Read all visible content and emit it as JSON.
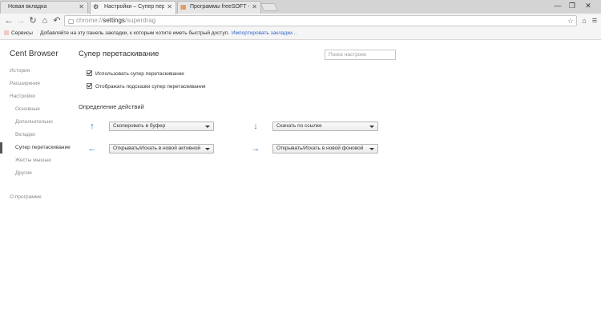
{
  "window": {
    "tabs": [
      {
        "title": "Новая вкладка",
        "icon": "blank-page-icon",
        "active": false
      },
      {
        "title": "Настройки – Супер перетаскивание",
        "icon": "gear-icon",
        "active": true
      },
      {
        "title": "Программы freeSOFT - ...",
        "icon": "site-icon",
        "active": false
      }
    ],
    "controls": {
      "minimize": "—",
      "maximize": "❐",
      "close": "✕"
    }
  },
  "toolbar": {
    "back": "←",
    "forward": "→",
    "reload": "↻",
    "home": "⌂",
    "undo": "↶",
    "url_scheme": "chrome://",
    "url_host": "settings",
    "url_path": "/superdrag",
    "star": "☆",
    "extensions": "⌂",
    "menu": "≡"
  },
  "bookmarks_bar": {
    "apps_label": "Сервисы",
    "hint": "Добавляйте на эту панель закладки, к которым хотите иметь быстрый доступ.",
    "import_link": "Импортировать закладки..."
  },
  "sidebar": {
    "brand": "Cent Browser",
    "items": [
      {
        "label": "История"
      },
      {
        "label": "Расширения"
      },
      {
        "label": "Настройки"
      },
      {
        "label": "Основные"
      },
      {
        "label": "Дополнительно"
      },
      {
        "label": "Вкладки"
      },
      {
        "label": "Супер перетаскивание",
        "selected": true
      },
      {
        "label": "Жесты мышью"
      },
      {
        "label": "Другие"
      },
      {
        "label": "О программе"
      }
    ]
  },
  "main": {
    "title": "Супер перетаскивание",
    "search_placeholder": "Поиск настроек",
    "options": [
      {
        "label": "Использовать супер перетаскивание",
        "checked": true
      },
      {
        "label": "Отображать подсказки супер перетаскивания",
        "checked": true
      }
    ],
    "actions_heading": "Определение действий",
    "actions": [
      {
        "direction": "up",
        "arrow": "↑",
        "value": "Скопировать в буфер"
      },
      {
        "direction": "down",
        "arrow": "↓",
        "value": "Скачать по ссылке"
      },
      {
        "direction": "left",
        "arrow": "←",
        "value": "Открывать/Искать в новой активной"
      },
      {
        "direction": "right",
        "arrow": "→",
        "value": "Открывать/Искать в новой фоновой"
      }
    ]
  },
  "colors": {
    "accent_arrow": "#2a7fd4",
    "link": "#3366cc",
    "sidebar_inactive": "#8a8a8a"
  }
}
